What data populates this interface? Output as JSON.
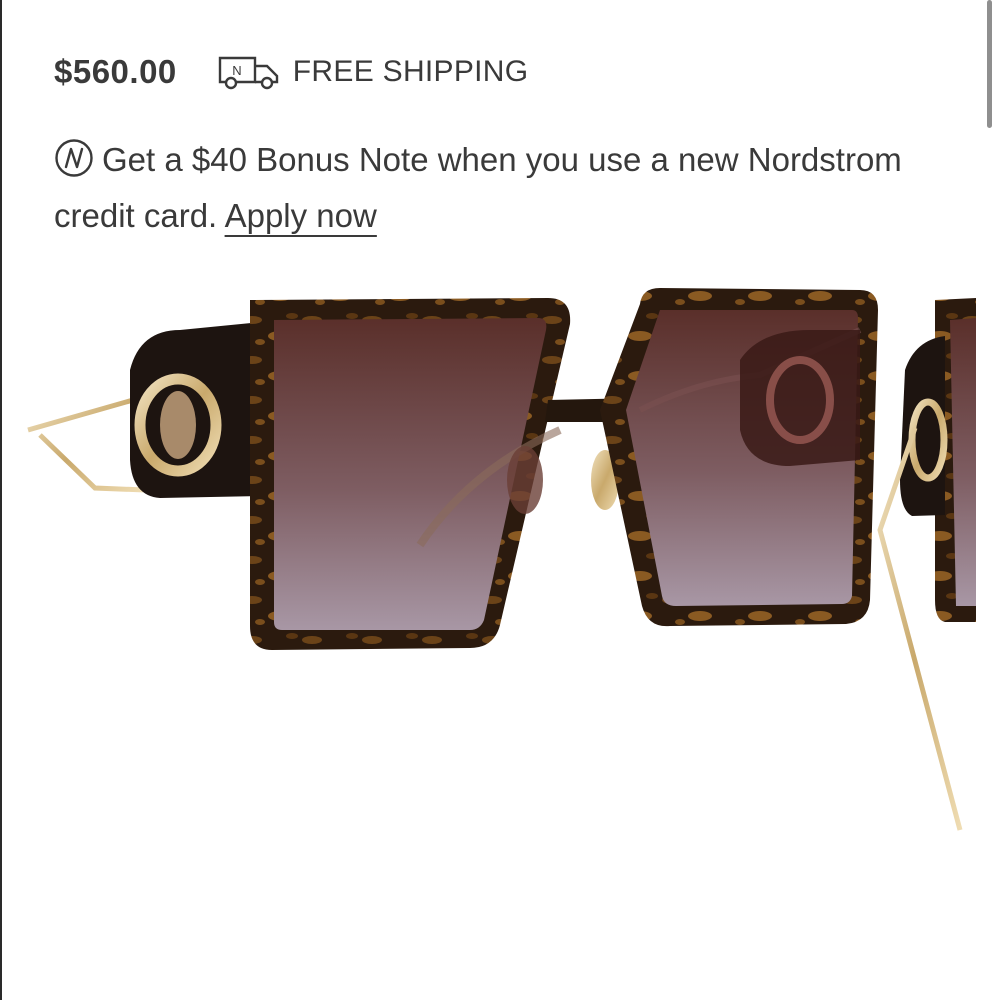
{
  "product": {
    "price": "$560.00",
    "shipping_label": "FREE SHIPPING",
    "shipping_icon_letter": "N",
    "image_alt": "Tortoise square oversized sunglasses with gold metal temples"
  },
  "promo": {
    "icon": "nordstrom-n-icon",
    "text_part1": "Get a $40 Bonus Note when you use a new Nordstrom credit card.",
    "link_label": "Apply now"
  },
  "colors": {
    "text": "#3a3a3a",
    "tortoise_dark": "#2b1a0e",
    "tortoise_light": "#8a5a22",
    "lens_top": "#5a2f2a",
    "lens_bottom": "#a493a0",
    "gold": "#d9c39a"
  }
}
